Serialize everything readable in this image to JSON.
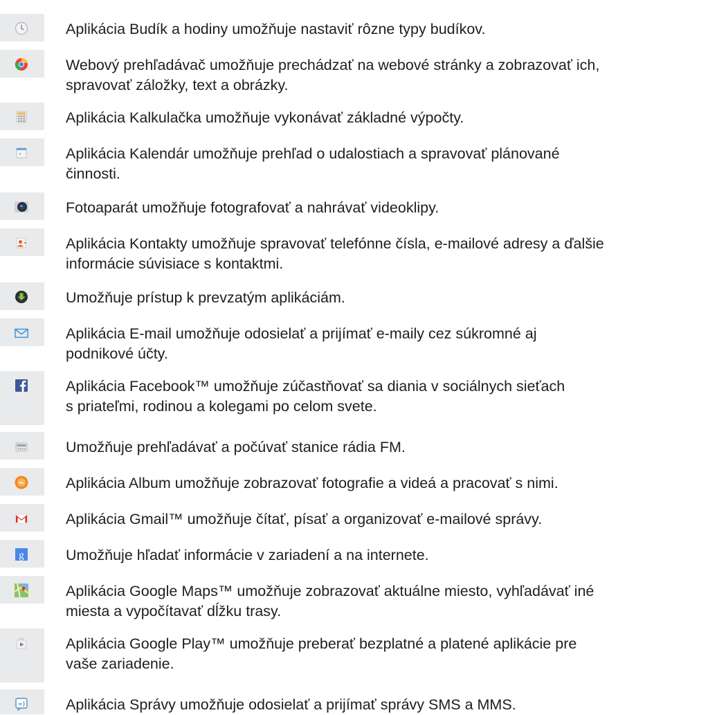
{
  "apps": [
    {
      "icon": "clock-icon",
      "lines": [
        "Aplikácia Budík a hodiny umožňuje nastaviť rôzne typy budíkov."
      ]
    },
    {
      "icon": "browser-icon",
      "lines": [
        "Webový prehľadávač umožňuje prechádzať na webové stránky a zobrazovať ich,",
        "spravovať záložky, text a obrázky."
      ]
    },
    {
      "icon": "calculator-icon",
      "lines": [
        "Aplikácia Kalkulačka umožňuje vykonávať základné výpočty."
      ]
    },
    {
      "icon": "calendar-icon",
      "lines": [
        "Aplikácia Kalendár umožňuje prehľad o udalostiach a spravovať plánované",
        "činnosti."
      ]
    },
    {
      "icon": "camera-icon",
      "lines": [
        "Fotoaparát umožňuje fotografovať a nahrávať videoklipy."
      ]
    },
    {
      "icon": "contacts-icon",
      "lines": [
        "Aplikácia Kontakty umožňuje spravovať telefónne čísla, e-mailové adresy a ďalšie",
        "informácie súvisiace s kontaktmi."
      ]
    },
    {
      "icon": "download-icon",
      "lines": [
        "Umožňuje prístup k prevzatým aplikáciám."
      ]
    },
    {
      "icon": "email-icon",
      "lines": [
        "Aplikácia E-mail umožňuje odosielať a prijímať e-maily cez súkromné aj",
        "podnikové účty."
      ]
    },
    {
      "icon": "facebook-icon",
      "lines": [
        "Aplikácia Facebook™ umožňuje zúčastňovať sa diania v sociálnych sieťach",
        "s priateľmi, rodinou a kolegami po celom svete."
      ]
    },
    {
      "icon": "fm-radio-icon",
      "lines": [
        "Umožňuje prehľadávať a počúvať stanice rádia FM."
      ]
    },
    {
      "icon": "album-icon",
      "lines": [
        "Aplikácia Album umožňuje zobrazovať fotografie a videá a pracovať s nimi."
      ]
    },
    {
      "icon": "gmail-icon",
      "lines": [
        "Aplikácia Gmail™ umožňuje čítať, písať a organizovať e-mailové správy."
      ]
    },
    {
      "icon": "google-search-icon",
      "lines": [
        "Umožňuje hľadať informácie v zariadení a na internete."
      ]
    },
    {
      "icon": "maps-icon",
      "lines": [
        "Aplikácia Google Maps™ umožňuje zobrazovať aktuálne miesto, vyhľadávať iné",
        "miesta a vypočítavať dĺžku trasy."
      ]
    },
    {
      "icon": "play-store-icon",
      "lines": [
        "Aplikácia Google Play™ umožňuje preberať bezplatné a platené aplikácie pre",
        "vaše zariadenie."
      ]
    },
    {
      "icon": "messaging-icon",
      "lines": [
        "Aplikácia Správy umožňuje odosielať a prijímať správy SMS a MMS."
      ]
    }
  ]
}
